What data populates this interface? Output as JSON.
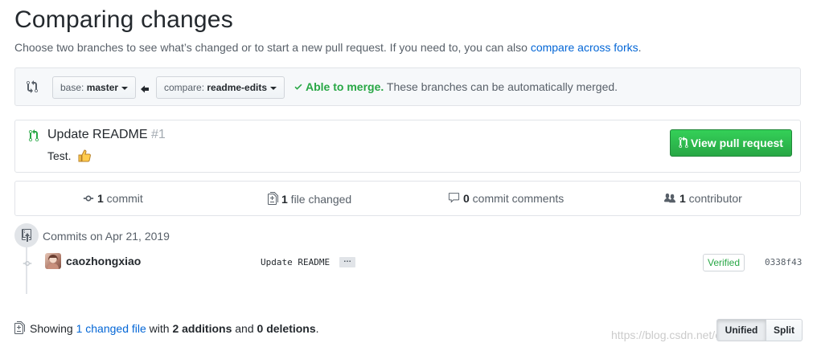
{
  "header": {
    "title": "Comparing changes",
    "subtitle_text": "Choose two branches to see what’s changed or to start a new pull request. If you need to, you can also ",
    "subtitle_link": "compare across forks",
    "subtitle_end": "."
  },
  "range": {
    "base_prefix": "base: ",
    "base_branch": "master",
    "compare_prefix": "compare: ",
    "compare_branch": "readme-edits",
    "merge_ok": "Able to merge.",
    "merge_text": " These branches can be automatically merged."
  },
  "pull_request": {
    "title": "Update README",
    "number": "#1",
    "description": "Test.",
    "view_button": "View pull request"
  },
  "stats": {
    "commits_count": "1",
    "commits_label": " commit",
    "files_count": "1",
    "files_label": " file changed",
    "comments_count": "0",
    "comments_label": " commit comments",
    "contributors_count": "1",
    "contributors_label": " contributor"
  },
  "commits": {
    "date_heading": "Commits on Apr 21, 2019",
    "items": [
      {
        "author": "caozhongxiao",
        "message": "Update README",
        "ellipsis": "…",
        "verified": "Verified",
        "sha": "0338f43"
      }
    ]
  },
  "diff_summary": {
    "prefix": "Showing ",
    "changed_files": "1 changed file",
    "with": " with ",
    "additions": "2 additions",
    "and": " and ",
    "deletions": "0 deletions",
    "end": ".",
    "unified": "Unified",
    "split": "Split"
  },
  "watermark": "https://blog.csdn.net/caozhongxiao",
  "colors": {
    "link": "#0366d6",
    "success": "#28a745",
    "muted": "#586069"
  },
  "icons": [
    "git-compare-icon",
    "triangle-down-icon",
    "arrow-left-icon",
    "check-icon",
    "git-pull-request-icon",
    "thumbs-up-icon",
    "git-commit-icon",
    "file-diff-icon",
    "comment-icon",
    "people-icon"
  ]
}
